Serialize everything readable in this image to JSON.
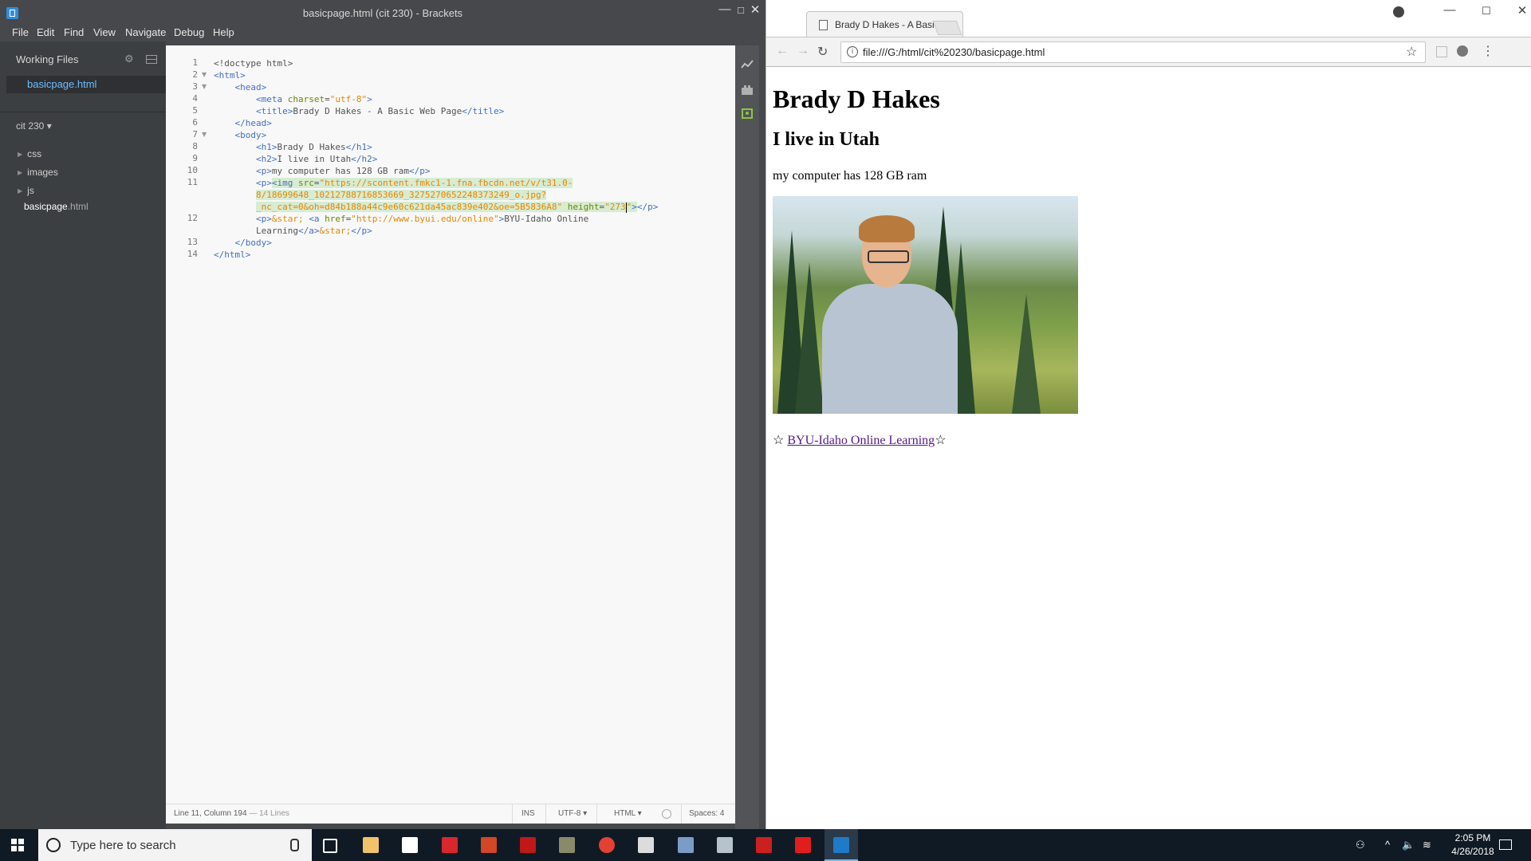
{
  "brackets": {
    "window_title": "basicpage.html (cit 230) - Brackets",
    "menu": [
      "File",
      "Edit",
      "Find",
      "View",
      "Navigate",
      "Debug",
      "Help"
    ],
    "working_files_header": "Working Files",
    "working_files": [
      "basicpage.html"
    ],
    "project_name": "cit 230 ▾",
    "tree": {
      "folders": [
        "css",
        "images",
        "js"
      ],
      "file_name": "basicpage",
      "file_ext": ".html"
    },
    "line_numbers": [
      "1",
      "2",
      "3",
      "4",
      "5",
      "6",
      "7",
      "8",
      "9",
      "10",
      "11",
      "",
      "",
      "12",
      "",
      "13",
      "14"
    ],
    "code": {
      "l1": "<!doctype html>",
      "l8_text": "Brady D Hakes",
      "l9_text": "I live in Utah",
      "l10_text": "my computer has 128 GB ram",
      "l5_text": "Brady D Hakes - A Basic Web Page",
      "meta_charset": "\"utf-8\"",
      "img_src_1": "\"https://scontent.fmkc1-1.fna.fbcdn.net/v/t31.0-",
      "img_src_2": "8/18699648_10212788716853669_3275270652248373249_o.jpg?",
      "img_src_3": "_nc_cat=0&oh=d84b188a44c9e60c621da45ac839e402&oe=5B5836A8\"",
      "img_height": "\"273",
      "img_height_end": "\"",
      "a_href": "\"http://www.byui.edu/online\"",
      "a_text_1": "BYU-Idaho Online",
      "a_text_2": "Learning",
      "entity": "&star;"
    },
    "status": {
      "position": "Line 11, Column 194",
      "lines": " — 14 Lines",
      "mode": "INS",
      "encoding": "UTF-8 ▾",
      "language": "HTML ▾",
      "spaces": "Spaces: 4"
    }
  },
  "chrome": {
    "tab_title": "Brady D Hakes - A Basic W",
    "url": "file:///G:/html/cit%20230/basicpage.html",
    "page": {
      "h1": "Brady D Hakes",
      "h2": "I live in Utah",
      "p": "my computer has 128 GB ram",
      "star": "☆",
      "link_text": "BYU-Idaho Online Learning"
    }
  },
  "taskbar": {
    "search_placeholder": "Type here to search",
    "time": "2:05 PM",
    "date": "4/26/2018"
  },
  "colors": {
    "brackets_bg": "#47484b",
    "sidebar_bg": "#3c3f41",
    "active_file": "#6bbeff",
    "tag_color": "#446fbd",
    "attr_color": "#6d8600",
    "string_color": "#e88501",
    "visited_link": "#551a8b",
    "taskbar_bg": "#101a24"
  }
}
